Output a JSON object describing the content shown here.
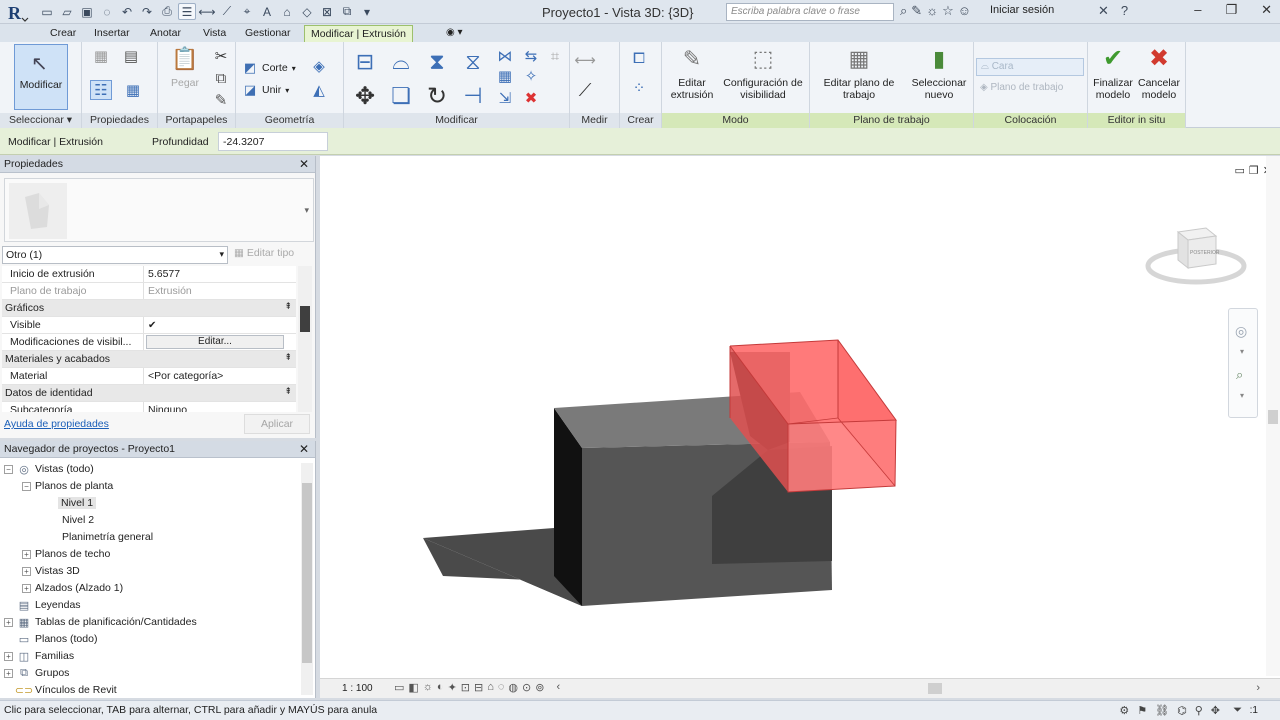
{
  "app": {
    "title": "Proyecto1 - Vista 3D: {3D}",
    "search_placeholder": "Escriba palabra clave o frase",
    "signin": "Iniciar sesión"
  },
  "tabs": [
    "Crear",
    "Insertar",
    "Anotar",
    "Vista",
    "Gestionar",
    "Modificar | Extrusión"
  ],
  "ribbon": {
    "seleccionar": {
      "button": "Modificar",
      "title": "Seleccionar ▾"
    },
    "propiedades": {
      "title": "Propiedades"
    },
    "portapapeles": {
      "paste": "Pegar",
      "title": "Portapapeles"
    },
    "geometria": {
      "cut": "Corte",
      "join": "Unir",
      "title": "Geometría"
    },
    "modificar": {
      "title": "Modificar"
    },
    "medir": {
      "title": "Medir"
    },
    "crear": {
      "title": "Crear"
    },
    "modo": {
      "edit_extrusion": "Editar extrusión",
      "visibility": "Configuración de visibilidad",
      "title": "Modo"
    },
    "plano": {
      "edit_plane": "Editar plano de trabajo",
      "title": "Plano de trabajo"
    },
    "colocacion": {
      "select_new": "Seleccionar nuevo",
      "face": "Cara",
      "workplane": "Plano de trabajo",
      "title": "Colocación"
    },
    "editor": {
      "finish": "Finalizar modelo",
      "cancel": "Cancelar modelo",
      "title": "Editor in situ"
    }
  },
  "optionsbar": {
    "context": "Modificar | Extrusión",
    "depth_label": "Profundidad",
    "depth_value": "-24.3207"
  },
  "properties": {
    "header": "Propiedades",
    "type_selector": "Otro (1)",
    "edit_type": "Editar tipo",
    "rows": [
      {
        "kind": "param",
        "name": "Inicio de extrusión",
        "value": "5.6577"
      },
      {
        "kind": "param",
        "name": "Plano de trabajo",
        "value": "Extrusión",
        "grey": true
      },
      {
        "kind": "group",
        "name": "Gráficos"
      },
      {
        "kind": "check",
        "name": "Visible",
        "value": "✔"
      },
      {
        "kind": "button",
        "name": "Modificaciones de visibil...",
        "value": "Editar..."
      },
      {
        "kind": "group",
        "name": "Materiales y acabados"
      },
      {
        "kind": "param",
        "name": "Material",
        "value": "<Por categoría>"
      },
      {
        "kind": "group",
        "name": "Datos de identidad"
      },
      {
        "kind": "param",
        "name": "Subcategoría",
        "value": "Ninguno"
      }
    ],
    "help": "Ayuda de propiedades",
    "apply": "Aplicar"
  },
  "browser": {
    "header": "Navegador de proyectos - Proyecto1",
    "items": [
      {
        "label": "Vistas (todo)",
        "level": 0,
        "toggle": "−",
        "icon": "views-icon"
      },
      {
        "label": "Planos de planta",
        "level": 1,
        "toggle": "−"
      },
      {
        "label": "Nivel 1",
        "level": 2,
        "highlight": true
      },
      {
        "label": "Nivel 2",
        "level": 2
      },
      {
        "label": "Planimetría general",
        "level": 2
      },
      {
        "label": "Planos de techo",
        "level": 1,
        "toggle": "+"
      },
      {
        "label": "Vistas 3D",
        "level": 1,
        "toggle": "+"
      },
      {
        "label": "Alzados (Alzado 1)",
        "level": 1,
        "toggle": "+"
      },
      {
        "label": "Leyendas",
        "level": 0,
        "icon": "legend-icon"
      },
      {
        "label": "Tablas de planificación/Cantidades",
        "level": 0,
        "toggle": "+",
        "icon": "table-icon"
      },
      {
        "label": "Planos (todo)",
        "level": 0,
        "icon": "sheet-icon"
      },
      {
        "label": "Familias",
        "level": 0,
        "toggle": "+",
        "icon": "family-icon"
      },
      {
        "label": "Grupos",
        "level": 0,
        "toggle": "+",
        "icon": "group-icon"
      },
      {
        "label": "Vínculos de Revit",
        "level": 0,
        "icon": "link-icon"
      }
    ]
  },
  "viewport": {
    "viewcube_label": "POSTERIOR",
    "scale": "1 : 100"
  },
  "status": {
    "text": "Clic para seleccionar, TAB para alternar, CTRL para añadir y MAYÚS para anula",
    "filter_count": ":1"
  },
  "colors": {
    "context_tab": "#e8f4d2",
    "extrusion_red": "#ff5555",
    "box_grey": "#555555"
  }
}
